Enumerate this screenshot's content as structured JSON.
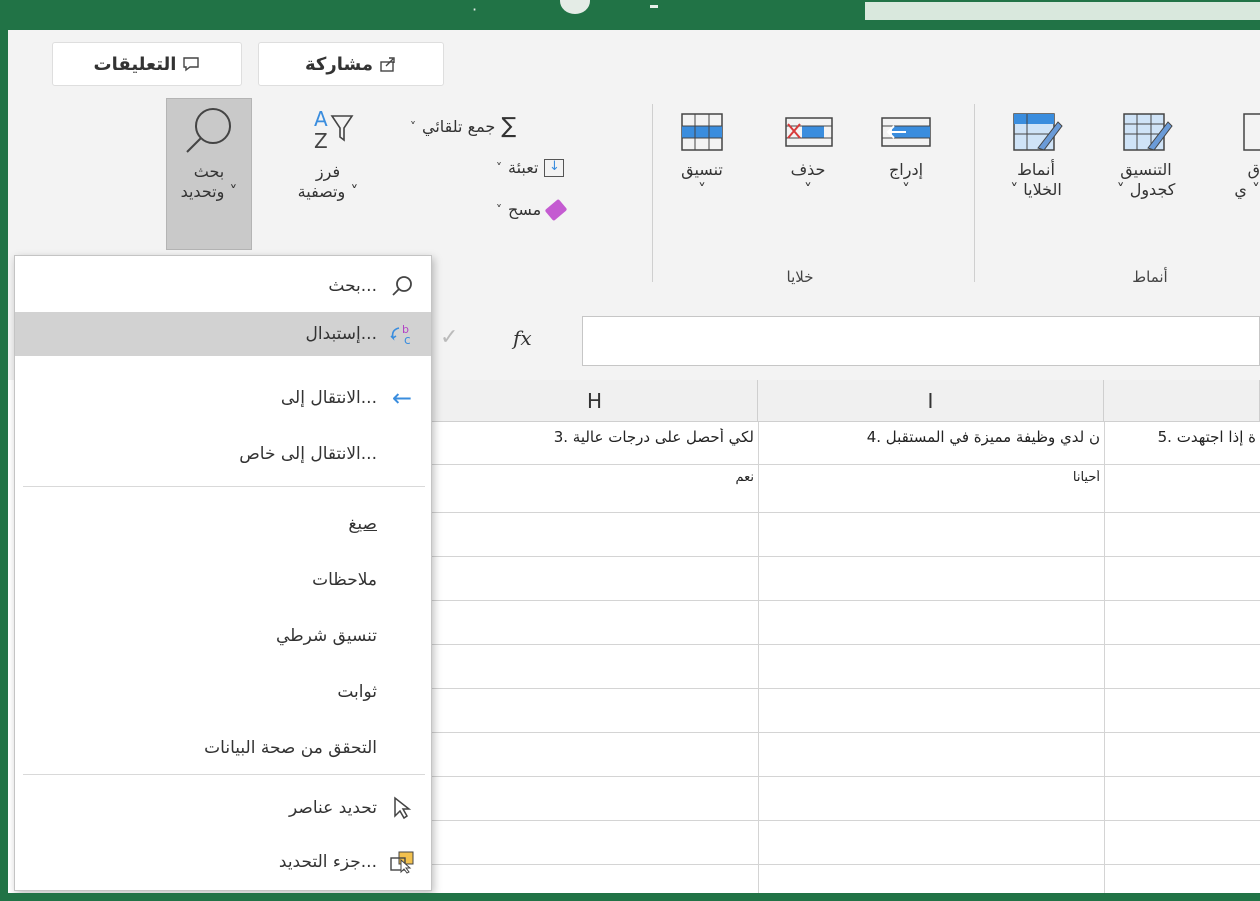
{
  "header": {
    "share_label": "مشاركة",
    "comments_label": "التعليقات"
  },
  "ribbon": {
    "editing": {
      "autosum_label": "جمع تلقائي",
      "fill_label": "تعبئة",
      "clear_label": "مسح",
      "sort_filter_line1": "فرز",
      "sort_filter_line2": "وتصفية",
      "find_select_line1": "بحث",
      "find_select_line2": "وتحديد"
    },
    "cells": {
      "group_label": "خلايا",
      "insert_label": "إدراج",
      "delete_label": "حذف",
      "format_label": "تنسيق"
    },
    "styles": {
      "group_label": "أنماط",
      "cell_styles_line1": "أنماط",
      "cell_styles_line2": "الخلايا",
      "format_table_line1": "التنسيق",
      "format_table_line2": "كجدول",
      "conditional_partial_line1": "ق",
      "conditional_partial_line2": "ي"
    }
  },
  "formula_bar": {
    "fx_label": "fx"
  },
  "sheet": {
    "columns": [
      "H",
      "I"
    ],
    "row1": {
      "h": "لكي أحصل على درجات عالية .3",
      "i": "ن لدي وظيفة مميزة في المستقبل .4",
      "j": "ة إذا اجتهدت .5"
    },
    "row2": {
      "h": "نعم",
      "i": "أحيانا"
    }
  },
  "dropdown_menu": {
    "items": [
      {
        "label": "بحث...",
        "icon": "search-icon"
      },
      {
        "label": "إستبدال...",
        "icon": "replace-icon"
      },
      {
        "label": "الانتقال إلى...",
        "icon": "arrow-left-icon"
      },
      {
        "label": "الانتقال إلى خاص..."
      },
      {
        "label": "صيغ"
      },
      {
        "label": "ملاحظات"
      },
      {
        "label": "تنسيق شرطي"
      },
      {
        "label": "ثوابت"
      },
      {
        "label": "التحقق من صحة البيانات"
      },
      {
        "label": "تحديد عناصر",
        "icon": "select-objects-icon"
      },
      {
        "label": "جزء التحديد...",
        "icon": "selection-pane-icon"
      }
    ]
  },
  "colors": {
    "accent": "#217346",
    "menu_highlight": "#d2d2d2",
    "icon_blue": "#3a8dde"
  }
}
